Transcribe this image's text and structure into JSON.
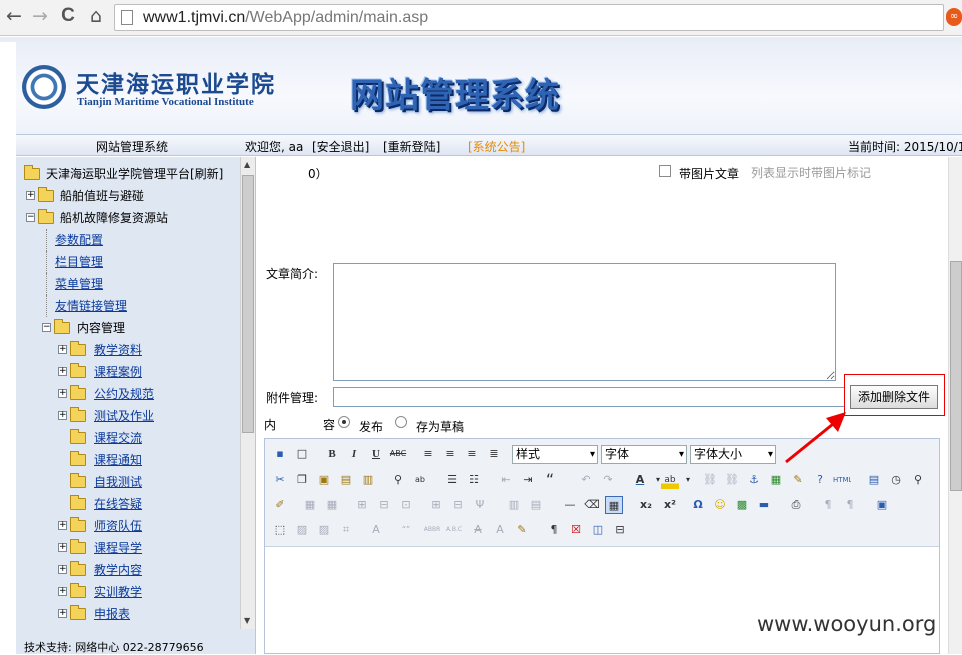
{
  "browser": {
    "url_host": "www1.tjmvi.cn",
    "url_path": "/WebApp/admin/main.asp",
    "back_icon": "←",
    "forward_icon": "→",
    "reload_icon": "C",
    "home_icon": "⌂",
    "ext_icon": "∞"
  },
  "banner": {
    "school_cn": "天津海运职业学院",
    "school_en": "Tianjin Maritime Vocational Institute",
    "title": "网站管理系统"
  },
  "topnav": {
    "system": "网站管理系统",
    "welcome": "欢迎您, aa",
    "logout": "[安全退出]",
    "relogin": "[重新登陆]",
    "notice": "[系统公告]",
    "time": "当前时间: 2015/10/1"
  },
  "tree": {
    "root": "天津海运职业学院管理平台[刷新]",
    "items": [
      {
        "label": "船舶值班与避碰"
      },
      {
        "label": "船机故障修复资源站"
      },
      {
        "label": "参数配置"
      },
      {
        "label": "栏目管理"
      },
      {
        "label": "菜单管理"
      },
      {
        "label": "友情链接管理"
      },
      {
        "label": "内容管理"
      },
      {
        "label": "教学资料"
      },
      {
        "label": "课程案例"
      },
      {
        "label": "公约及规范"
      },
      {
        "label": "测试及作业"
      },
      {
        "label": "课程交流"
      },
      {
        "label": "课程通知"
      },
      {
        "label": "自我测试"
      },
      {
        "label": "在线答疑"
      },
      {
        "label": "师资队伍"
      },
      {
        "label": "课程导学"
      },
      {
        "label": "教学内容"
      },
      {
        "label": "实训教学"
      },
      {
        "label": "申报表"
      }
    ]
  },
  "support": "技术支持: 网络中心 022-28779656",
  "form": {
    "top_text": "0）",
    "pic_article": "带图片文章",
    "pic_hint": "列表显示时带图片标记",
    "intro_label": "文章简介:",
    "attach_label": "附件管理:",
    "add_file_btn": "添加删除文件",
    "content_label_a": "内",
    "content_label_b": "容",
    "publish": "发布",
    "draft": "存为草稿",
    "style_select": "样式",
    "font_select": "字体",
    "size_select": "字体大小"
  },
  "colors": {
    "annotation": "#e00000",
    "link": "#0a3a9a",
    "notice": "#e58a00"
  },
  "watermark": "www.wooyun.org"
}
